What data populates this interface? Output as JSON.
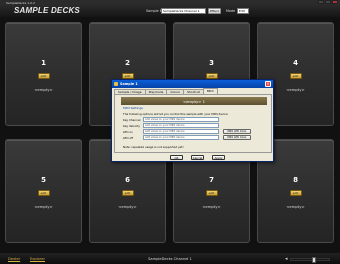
{
  "window": {
    "title": "SampleDecks 1.0.2"
  },
  "header": {
    "logo": "SAMPLE DECKS",
    "sample_bank_label": "Sample Bank",
    "sample_bank_value": "SampleDecks Channel 1",
    "effects_label": "Effect",
    "mode_label": "Mode",
    "mode_value": "Edit"
  },
  "tiles": [
    {
      "number": "1",
      "edit_label": "edit",
      "status": "<empty>"
    },
    {
      "number": "2",
      "edit_label": "edit",
      "status": "<empty>"
    },
    {
      "number": "3",
      "edit_label": "edit",
      "status": "<empty>"
    },
    {
      "number": "4",
      "edit_label": "edit",
      "status": "<empty>"
    },
    {
      "number": "5",
      "edit_label": "edit",
      "status": "<empty>"
    },
    {
      "number": "6",
      "edit_label": "edit",
      "status": "<empty>"
    },
    {
      "number": "7",
      "edit_label": "edit",
      "status": "<empty>"
    },
    {
      "number": "8",
      "edit_label": "edit",
      "status": "<empty>"
    }
  ],
  "dialog": {
    "title": "Sample 1",
    "tabs": [
      "Sample / Image",
      "Playmode",
      "Colour",
      "Shortcut",
      "MIDI"
    ],
    "active_tab": 4,
    "header": "<empty> 1",
    "section": "MIDI Settings",
    "note": "The following options will let you control this sample with your MIDI device",
    "rows": [
      {
        "label": "Key Channel",
        "value": "Add value on your MIDI device",
        "button": ""
      },
      {
        "label": "Key Velocity",
        "value": "Add value on your MIDI device",
        "button": ""
      },
      {
        "label": "LED on",
        "value": "Add value on your MIDI device",
        "button": "MIDI LED Color"
      },
      {
        "label": "LED off",
        "value": "Add value on your MIDI device",
        "button": "MIDI LED Color"
      }
    ],
    "footer": "Note: repeated usage is not supported yet!",
    "buttons": {
      "ok": "OK",
      "cancel": "Cancel",
      "apply": "Apply"
    }
  },
  "footer": {
    "left1": "Dexter",
    "left2": "Explorer",
    "center": "SampleDecks Channel 1"
  },
  "volume": {
    "level": 0.55
  }
}
